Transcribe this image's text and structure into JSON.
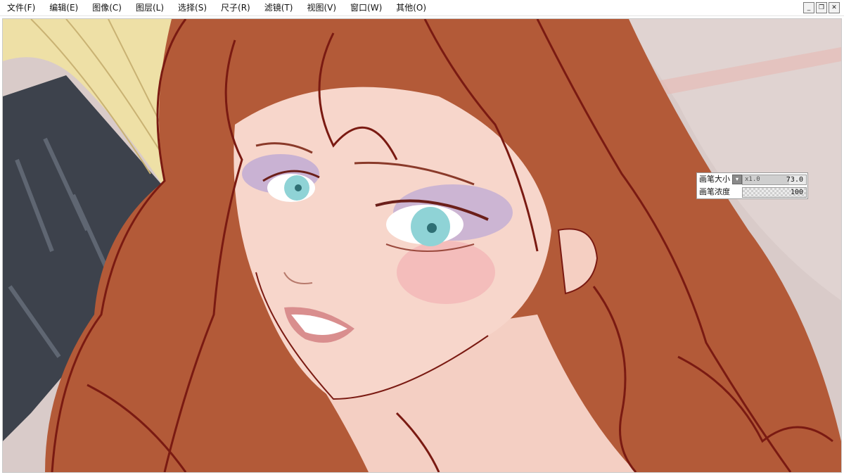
{
  "menubar": {
    "items": [
      "文件(F)",
      "编辑(E)",
      "图像(C)",
      "图层(L)",
      "选择(S)",
      "尺子(R)",
      "滤镜(T)",
      "视图(V)",
      "窗口(W)",
      "其他(O)"
    ]
  },
  "window_controls": {
    "minimize": "_",
    "restore": "❐",
    "close": "✕"
  },
  "brush_panel": {
    "size_label": "画笔大小",
    "size_multiplier": "x1.0",
    "size_value": "73.0",
    "size_level": 0.73,
    "density_label": "画笔浓度",
    "density_value": "100",
    "density_level": 1.0
  },
  "colors": {
    "hair": "#b35a38",
    "hair_line": "#7a1a12",
    "skin": "#f6d2c6",
    "eyes": "#8fd3d6",
    "eyeshadow": "#b9a6d6",
    "blonde_hair": "#efe0a8",
    "dark_cloth": "#3c4048",
    "background": "#d6c6c4"
  }
}
